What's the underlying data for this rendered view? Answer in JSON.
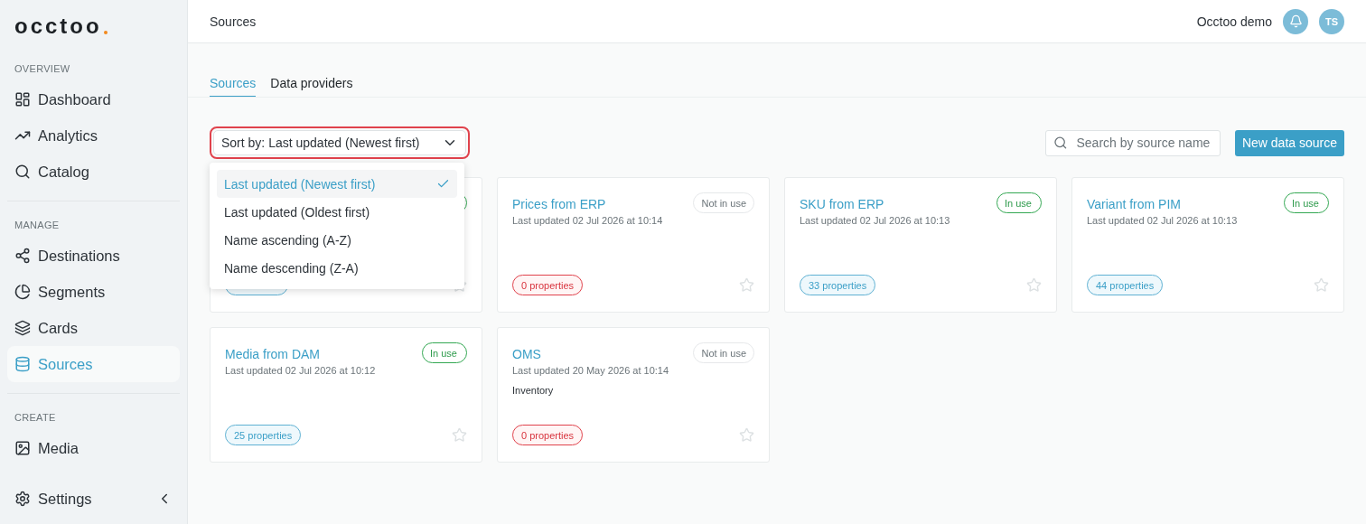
{
  "logo": {
    "text": "occtoo"
  },
  "sidebar": {
    "sections": [
      {
        "heading": "OVERVIEW",
        "items": [
          {
            "label": "Dashboard",
            "selected": false
          },
          {
            "label": "Analytics",
            "selected": false
          },
          {
            "label": "Catalog",
            "selected": false
          }
        ]
      },
      {
        "heading": "MANAGE",
        "items": [
          {
            "label": "Destinations",
            "selected": false
          },
          {
            "label": "Segments",
            "selected": false
          },
          {
            "label": "Cards",
            "selected": false
          },
          {
            "label": "Sources",
            "selected": true
          }
        ]
      },
      {
        "heading": "CREATE",
        "items": [
          {
            "label": "Media",
            "selected": false
          }
        ]
      }
    ],
    "footer": {
      "label": "Settings"
    }
  },
  "header": {
    "title": "Sources",
    "account": "Occtoo demo",
    "avatar": "TS"
  },
  "tabs": [
    {
      "label": "Sources",
      "selected": true
    },
    {
      "label": "Data providers",
      "selected": false
    }
  ],
  "sort": {
    "value": "Sort by: Last updated (Newest first)",
    "expanded": true,
    "options": [
      {
        "label": "Last updated (Newest first)",
        "selected": true
      },
      {
        "label": "Last updated (Oldest first)",
        "selected": false
      },
      {
        "label": "Name ascending (A-Z)",
        "selected": false
      },
      {
        "label": "Name descending (Z-A)",
        "selected": false
      }
    ]
  },
  "search": {
    "placeholder": "Search by source name"
  },
  "new_button": "New data source",
  "cards": [
    {
      "in_use": true,
      "empty": false
    },
    {
      "title": "Prices from ERP",
      "status": "Not in use",
      "in_use": false,
      "updated": "Last updated 02 Jul 2026 at 10:14",
      "properties": "0 properties",
      "empty": true
    },
    {
      "title": "SKU from ERP",
      "status": "In use",
      "in_use": true,
      "updated": "Last updated 02 Jul 2026 at 10:13",
      "properties": "33 properties",
      "empty": false
    },
    {
      "title": "Variant from PIM",
      "status": "In use",
      "in_use": true,
      "updated": "Last updated 02 Jul 2026 at 10:13",
      "properties": "44 properties",
      "empty": false
    },
    {
      "title": "Media from DAM",
      "status": "In use",
      "in_use": true,
      "updated": "Last updated 02 Jul 2026 at 10:12",
      "properties": "25 properties",
      "empty": false
    },
    {
      "title": "OMS",
      "status": "Not in use",
      "in_use": false,
      "updated": "Last updated 20 May 2026 at 10:14",
      "description": "Inventory",
      "properties": "0 properties",
      "empty": true
    }
  ]
}
